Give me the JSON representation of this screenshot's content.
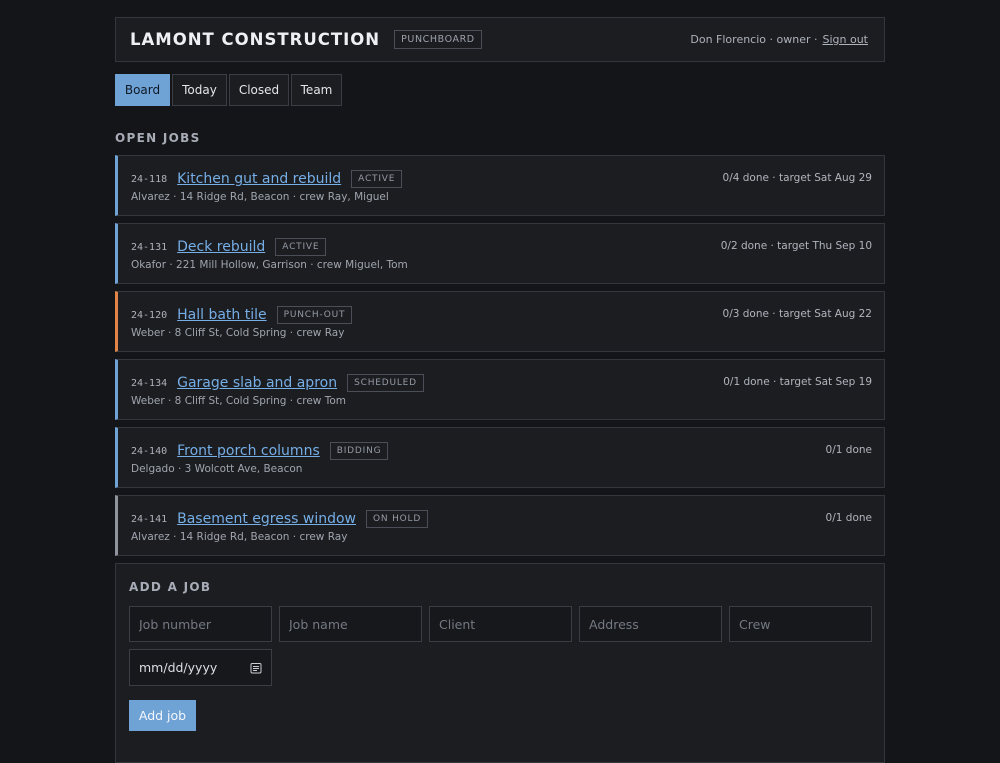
{
  "header": {
    "brand": "LAMONT CONSTRUCTION",
    "badge": "PUNCHBOARD",
    "user": "Don Florencio · owner ·",
    "signout": "Sign out"
  },
  "tabs": [
    {
      "label": "Board",
      "active": true
    },
    {
      "label": "Today",
      "active": false
    },
    {
      "label": "Closed",
      "active": false
    },
    {
      "label": "Team",
      "active": false
    }
  ],
  "open_jobs_title": "OPEN JOBS",
  "jobs": [
    {
      "number": "24-118",
      "name": "Kitchen gut and rebuild",
      "status": "ACTIVE",
      "meta": "Alvarez · 14 Ridge Rd, Beacon · crew Ray, Miguel",
      "progress": "0/4 done · target Sat Aug 29"
    },
    {
      "number": "24-131",
      "name": "Deck rebuild",
      "status": "ACTIVE",
      "meta": "Okafor · 221 Mill Hollow, Garrison · crew Miguel, Tom",
      "progress": "0/2 done · target Thu Sep 10"
    },
    {
      "number": "24-120",
      "name": "Hall bath tile",
      "status": "PUNCH-OUT",
      "meta": "Weber · 8 Cliff St, Cold Spring · crew Ray",
      "progress": "0/3 done · target Sat Aug 22"
    },
    {
      "number": "24-134",
      "name": "Garage slab and apron",
      "status": "SCHEDULED",
      "meta": "Weber · 8 Cliff St, Cold Spring · crew Tom",
      "progress": "0/1 done · target Sat Sep 19"
    },
    {
      "number": "24-140",
      "name": "Front porch columns",
      "status": "BIDDING",
      "meta": "Delgado · 3 Wolcott Ave, Beacon",
      "progress": "0/1 done"
    },
    {
      "number": "24-141",
      "name": "Basement egress window",
      "status": "ON HOLD",
      "meta": "Alvarez · 14 Ridge Rd, Beacon · crew Ray",
      "progress": "0/1 done"
    }
  ],
  "add_job": {
    "title": "ADD A JOB",
    "placeholders": {
      "number": "Job number",
      "name": "Job name",
      "client": "Client",
      "address": "Address",
      "crew": "Crew"
    },
    "date_placeholder": "mm/dd/yyyy",
    "button": "Add job"
  },
  "colors": {
    "accent": "#6fa2d5",
    "punch_out": "#e08547",
    "on_hold": "#8f949c"
  }
}
